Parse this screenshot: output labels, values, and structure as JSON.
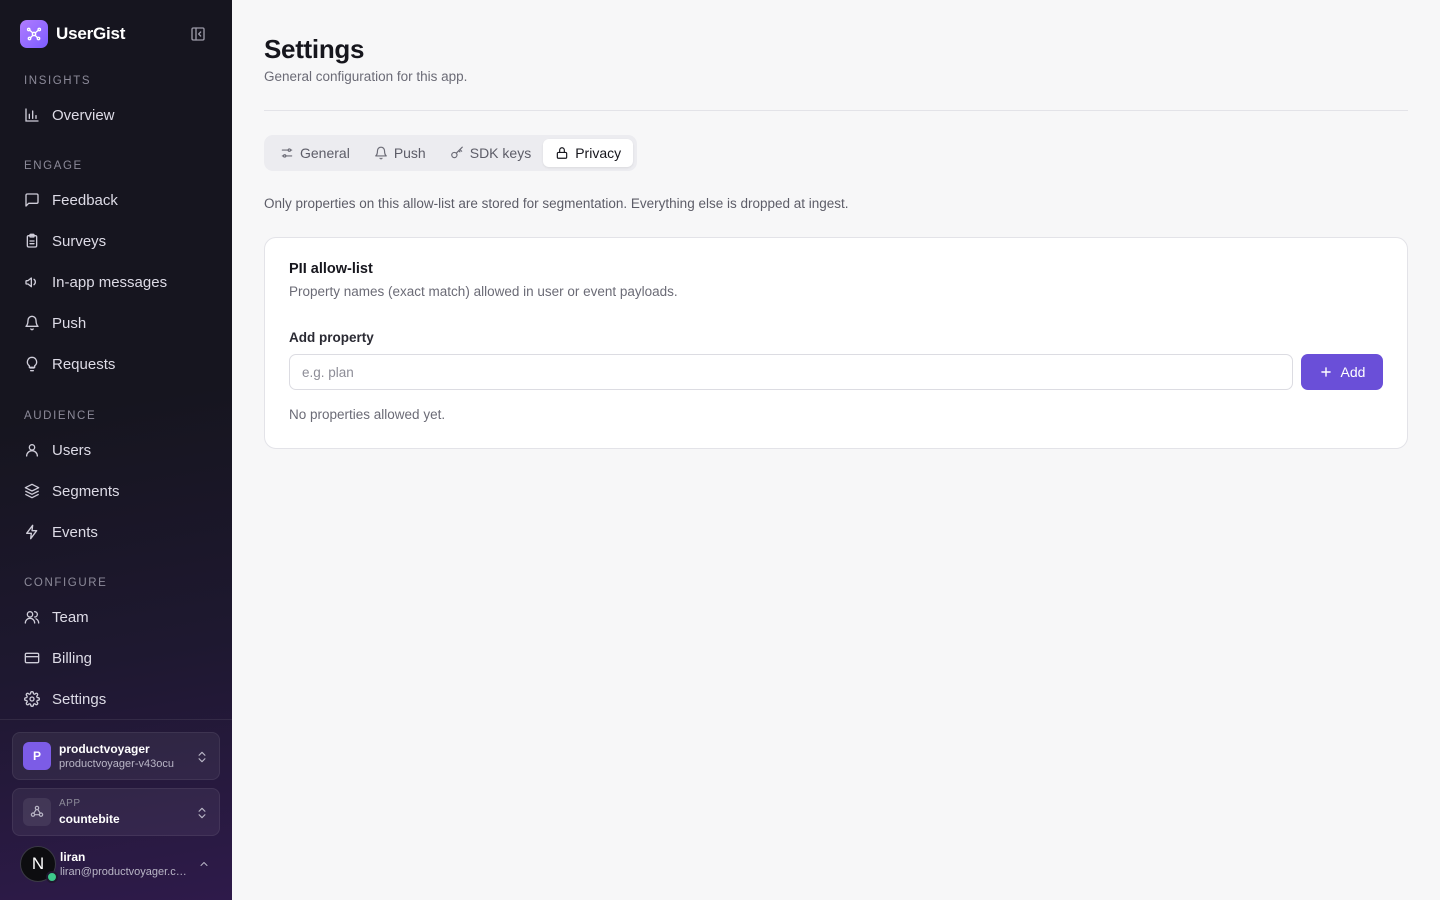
{
  "brand": {
    "name": "UserGist",
    "logo_icon": "sparkle-network-icon"
  },
  "sidebar": {
    "sections": [
      {
        "label": "INSIGHTS",
        "items": [
          {
            "label": "Overview",
            "icon": "bar-chart-icon"
          }
        ]
      },
      {
        "label": "ENGAGE",
        "items": [
          {
            "label": "Feedback",
            "icon": "message-square-icon"
          },
          {
            "label": "Surveys",
            "icon": "clipboard-icon"
          },
          {
            "label": "In-app messages",
            "icon": "megaphone-icon"
          },
          {
            "label": "Push",
            "icon": "bell-icon"
          },
          {
            "label": "Requests",
            "icon": "lightbulb-icon"
          }
        ]
      },
      {
        "label": "AUDIENCE",
        "items": [
          {
            "label": "Users",
            "icon": "user-icon"
          },
          {
            "label": "Segments",
            "icon": "layers-icon"
          },
          {
            "label": "Events",
            "icon": "zap-icon"
          }
        ]
      },
      {
        "label": "CONFIGURE",
        "items": [
          {
            "label": "Team",
            "icon": "users-icon"
          },
          {
            "label": "Billing",
            "icon": "credit-card-icon"
          },
          {
            "label": "Settings",
            "icon": "gear-icon"
          }
        ]
      }
    ],
    "org": {
      "initial": "P",
      "name": "productvoyager",
      "slug": "productvoyager-v43ocu"
    },
    "app": {
      "caption": "APP",
      "name": "countebite"
    },
    "user": {
      "initial": "N",
      "name": "liran",
      "email": "liran@productvoyager.co..."
    }
  },
  "page": {
    "title": "Settings",
    "subtitle": "General configuration for this app.",
    "tabs": [
      {
        "label": "General",
        "icon": "sliders-icon",
        "active": false
      },
      {
        "label": "Push",
        "icon": "bell-icon",
        "active": false
      },
      {
        "label": "SDK keys",
        "icon": "key-icon",
        "active": false
      },
      {
        "label": "Privacy",
        "icon": "lock-icon",
        "active": true
      }
    ],
    "intro": "Only properties on this allow-list are stored for segmentation. Everything else is dropped at ingest.",
    "card": {
      "title": "PII allow-list",
      "description": "Property names (exact match) allowed in user or event payloads.",
      "field_label": "Add property",
      "input_value": "",
      "input_placeholder": "e.g. plan",
      "add_label": "Add",
      "empty_text": "No properties allowed yet."
    }
  },
  "colors": {
    "accent": "#6a4fd8",
    "sidebar_bg": "#16151f",
    "brand_gradient_start": "#b07cff"
  }
}
